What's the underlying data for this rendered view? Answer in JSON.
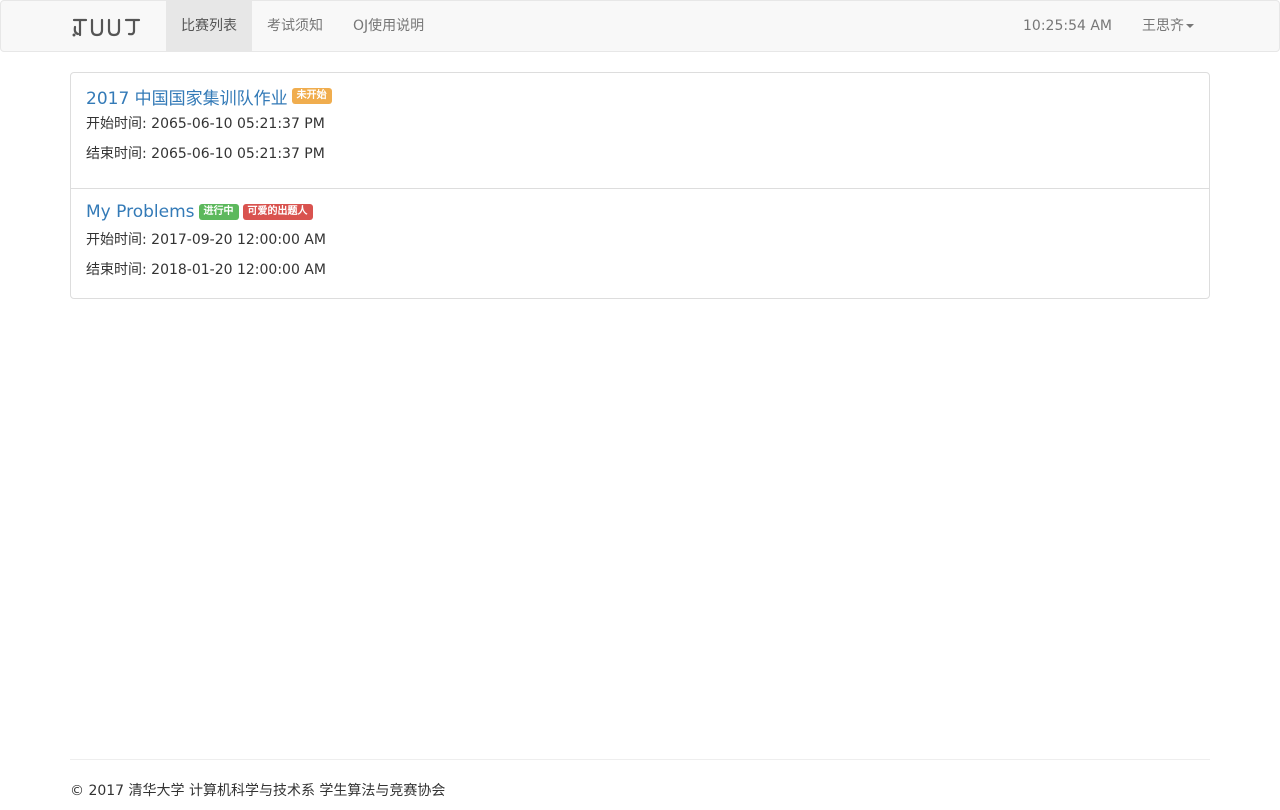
{
  "navbar": {
    "brand": "THUOJ",
    "items": [
      {
        "label": "比赛列表",
        "active": true
      },
      {
        "label": "考试须知",
        "active": false
      },
      {
        "label": "OJ使用说明",
        "active": false
      }
    ],
    "clock": "10:25:54 AM",
    "user": "王思齐"
  },
  "contests": [
    {
      "title": "2017 中国国家集训队作业",
      "badges": [
        {
          "text": "未开始",
          "color": "#f0ad4e"
        }
      ],
      "start": "开始时间: 2065-06-10 05:21:37 PM",
      "end": "结束时间: 2065-06-10 05:21:37 PM"
    },
    {
      "title": "My Problems",
      "badges": [
        {
          "text": "进行中",
          "color": "#5cb85c"
        },
        {
          "text": "可爱的出题人",
          "color": "#d9534f"
        }
      ],
      "start": "开始时间: 2017-09-20 12:00:00 AM",
      "end": "结束时间: 2018-01-20 12:00:00 AM"
    }
  ],
  "footer": {
    "text": "© 2017 清华大学 计算机科学与技术系 学生算法与竞赛协会"
  },
  "colors": {
    "link": "#337ab7",
    "navbar_bg": "#f8f8f8",
    "active_tab_bg": "#e7e7e7"
  }
}
